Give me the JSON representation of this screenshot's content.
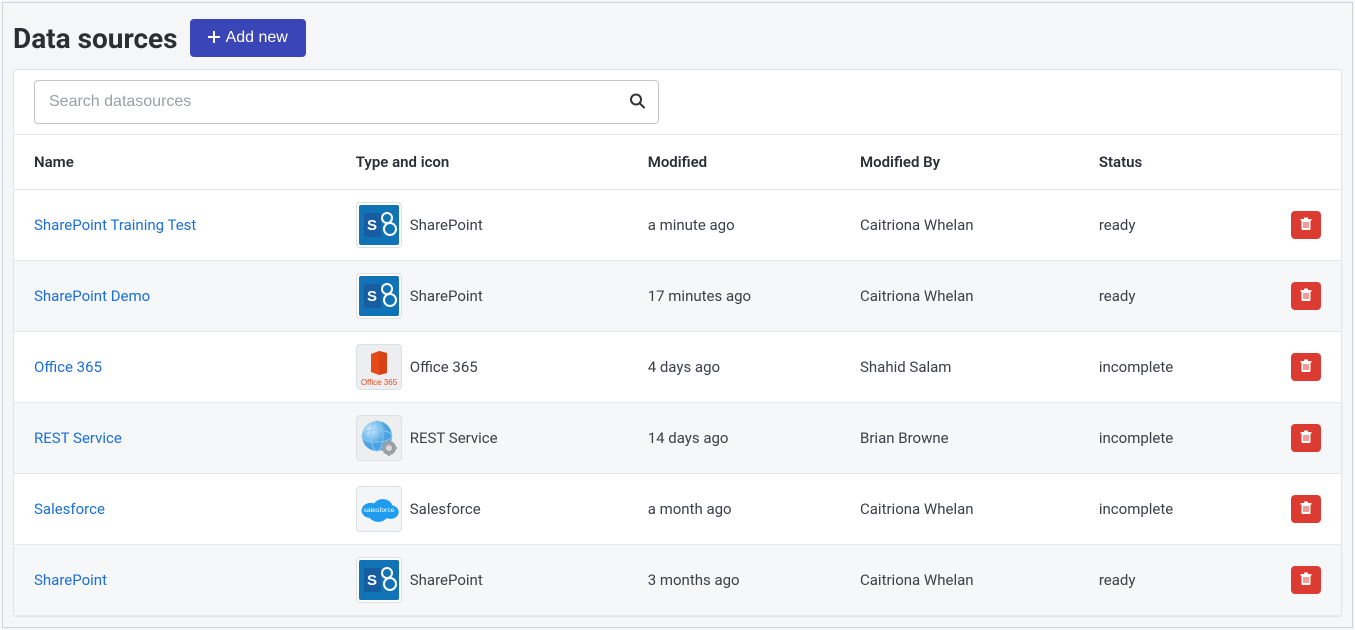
{
  "header": {
    "title": "Data sources",
    "add_label": "Add new"
  },
  "search": {
    "placeholder": "Search datasources",
    "value": ""
  },
  "table": {
    "columns": {
      "name": "Name",
      "type": "Type and icon",
      "modified": "Modified",
      "modified_by": "Modified By",
      "status": "Status"
    },
    "rows": [
      {
        "name": "SharePoint Training Test",
        "type": "SharePoint",
        "icon": "sharepoint",
        "modified": "a minute ago",
        "modified_by": "Caitriona Whelan",
        "status": "ready"
      },
      {
        "name": "SharePoint Demo",
        "type": "SharePoint",
        "icon": "sharepoint",
        "modified": "17 minutes ago",
        "modified_by": "Caitriona Whelan",
        "status": "ready"
      },
      {
        "name": "Office 365",
        "type": "Office 365",
        "icon": "office365",
        "modified": "4 days ago",
        "modified_by": "Shahid Salam",
        "status": "incomplete"
      },
      {
        "name": "REST Service",
        "type": "REST Service",
        "icon": "rest",
        "modified": "14 days ago",
        "modified_by": "Brian Browne",
        "status": "incomplete"
      },
      {
        "name": "Salesforce",
        "type": "Salesforce",
        "icon": "salesforce",
        "modified": "a month ago",
        "modified_by": "Caitriona Whelan",
        "status": "incomplete"
      },
      {
        "name": "SharePoint",
        "type": "SharePoint",
        "icon": "sharepoint",
        "modified": "3 months ago",
        "modified_by": "Caitriona Whelan",
        "status": "ready"
      }
    ]
  }
}
